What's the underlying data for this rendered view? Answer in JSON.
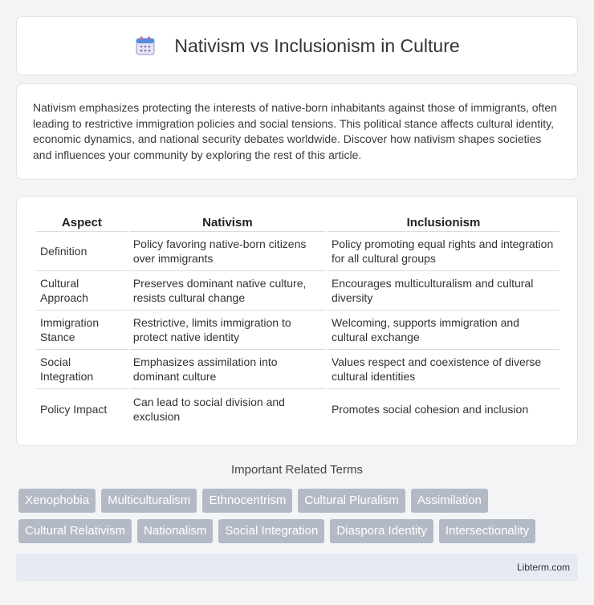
{
  "header": {
    "title": "Nativism vs Inclusionism in Culture",
    "icon": "calendar-icon"
  },
  "intro": {
    "text": "Nativism emphasizes protecting the interests of native-born inhabitants against those of immigrants, often leading to restrictive immigration policies and social tensions. This political stance affects cultural identity, economic dynamics, and national security debates worldwide. Discover how nativism shapes societies and influences your community by exploring the rest of this article."
  },
  "table": {
    "headers": [
      "Aspect",
      "Nativism",
      "Inclusionism"
    ],
    "rows": [
      [
        "Definition",
        "Policy favoring native-born citizens over immigrants",
        "Policy promoting equal rights and integration for all cultural groups"
      ],
      [
        "Cultural Approach",
        "Preserves dominant native culture, resists cultural change",
        "Encourages multiculturalism and cultural diversity"
      ],
      [
        "Immigration Stance",
        "Restrictive, limits immigration to protect native identity",
        "Welcoming, supports immigration and cultural exchange"
      ],
      [
        "Social Integration",
        "Emphasizes assimilation into dominant culture",
        "Values respect and coexistence of diverse cultural identities"
      ],
      [
        "Policy Impact",
        "Can lead to social division and exclusion",
        "Promotes social cohesion and inclusion"
      ]
    ]
  },
  "related": {
    "heading": "Important Related Terms",
    "row1": [
      "Xenophobia",
      "Multiculturalism",
      "Ethnocentrism",
      "Cultural Pluralism",
      "Assimilation"
    ],
    "row2": [
      "Cultural Relativism",
      "Nationalism",
      "Social Integration",
      "Diaspora Identity",
      "Intersectionality"
    ]
  },
  "footer": {
    "brand": "Libterm.com"
  },
  "colors": {
    "tag_bg": "#b3bac6",
    "footer_bg": "#e6eaf3",
    "page_bg": "#f3f4f6"
  }
}
